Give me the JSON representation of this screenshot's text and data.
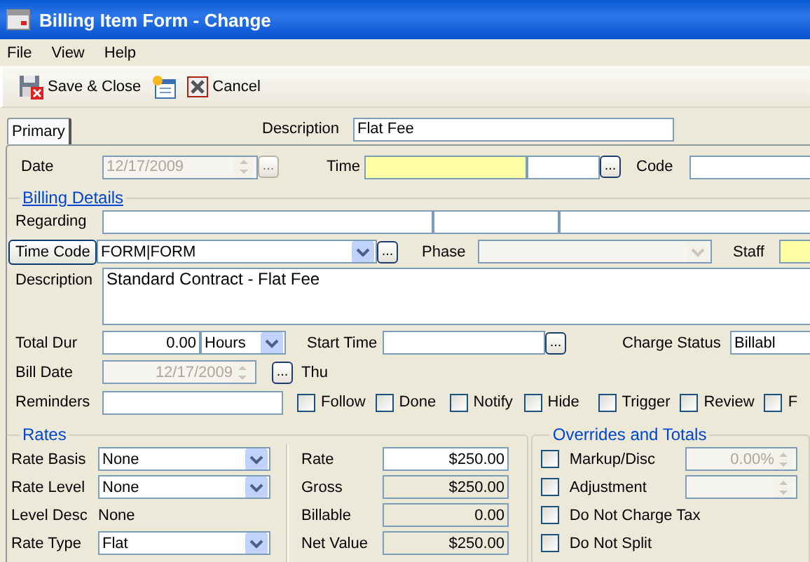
{
  "window": {
    "title": "Billing Item Form - Change"
  },
  "menu": [
    "File",
    "View",
    "Help"
  ],
  "toolbar": [
    {
      "kind": "save",
      "label": "Save & Close"
    },
    {
      "kind": "new"
    },
    {
      "kind": "cancel",
      "label": "Cancel"
    }
  ],
  "tabs": [
    {
      "label": "Primary",
      "selected": true
    }
  ],
  "header": {
    "label": "Description",
    "value": "Flat Fee"
  },
  "date_row": {
    "date": {
      "label": "Date",
      "value": "12/17/2009",
      "disabled": true,
      "browse": "..."
    },
    "time": {
      "label": "Time",
      "required": true,
      "browse": "..."
    },
    "code": {
      "label": "Code"
    }
  },
  "billing_details": {
    "title": "Billing Details",
    "regarding": {
      "label": "Regarding"
    },
    "time_code": {
      "label": "Time Code",
      "value": "FORM|FORM",
      "browse": "..."
    },
    "phase": {
      "label": "Phase",
      "disabled": true
    },
    "staff": {
      "label": "Staff",
      "required": true
    },
    "description": {
      "label": "Description",
      "value": "Standard Contract - Flat Fee"
    },
    "total_dur": {
      "label": "Total Dur",
      "value": "0.00",
      "unit": "Hours"
    },
    "start_time": {
      "label": "Start Time",
      "browse": "..."
    },
    "charge_status": {
      "label": "Charge Status",
      "value": "Billabl"
    },
    "bill_date": {
      "label": "Bill Date",
      "value": "12/17/2009",
      "disabled": true,
      "browse": "...",
      "weekday": "Thu"
    },
    "reminders": {
      "label": "Reminders"
    },
    "flags": [
      {
        "label": "Follow",
        "checked": false
      },
      {
        "label": "Done",
        "checked": false
      },
      {
        "label": "Notify",
        "checked": false
      },
      {
        "label": "Hide",
        "checked": false
      },
      {
        "label": "Trigger",
        "checked": false
      },
      {
        "label": "Review",
        "checked": false
      },
      {
        "label": "F",
        "checked": false
      }
    ]
  },
  "rates": {
    "title": "Rates",
    "fields": [
      {
        "kind": "select",
        "label": "Rate Basis",
        "value": "None"
      },
      {
        "kind": "select",
        "label": "Rate Level",
        "value": "None"
      },
      {
        "kind": "text",
        "label": "Level Desc",
        "value": "None"
      },
      {
        "kind": "select",
        "label": "Rate Type",
        "value": "Flat"
      }
    ],
    "amounts": [
      {
        "label": "Rate",
        "value": "$250.00",
        "readonly": false
      },
      {
        "label": "Gross",
        "value": "$250.00",
        "readonly": true
      },
      {
        "label": "Billable",
        "value": "0.00",
        "readonly": true
      },
      {
        "label": "Net Value",
        "value": "$250.00",
        "readonly": true
      }
    ]
  },
  "overrides": {
    "title": "Overrides and Totals",
    "items": [
      {
        "kind": "spin",
        "label": "Markup/Disc",
        "checked": false,
        "value": "0.00%",
        "disabled": true
      },
      {
        "kind": "spin",
        "label": "Adjustment",
        "checked": false,
        "disabled": true
      },
      {
        "kind": "plain",
        "label": "Do Not Charge Tax",
        "checked": false
      },
      {
        "kind": "plain",
        "label": "Do Not Split",
        "checked": false
      }
    ]
  }
}
